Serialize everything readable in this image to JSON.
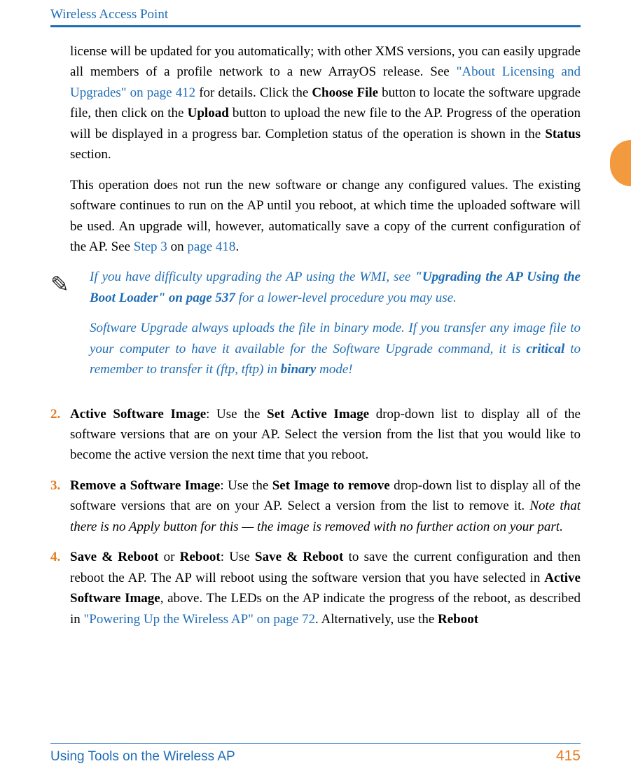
{
  "header": {
    "title": "Wireless Access Point"
  },
  "para1": {
    "t1": "license will be updated for you automatically; with other XMS versions, you can easily upgrade all members of a profile network to a new ArrayOS release. See ",
    "link1": "\"About Licensing and Upgrades\" on page 412",
    "t2": " for details. Click the ",
    "b1": "Choose File",
    "t3": " button to locate the software upgrade file, then click on the ",
    "b2": "Upload",
    "t4": " button to upload the new file to the AP. Progress of the operation will be displayed in a progress bar. Completion status of the operation is shown in the ",
    "b3": "Status",
    "t5": " section."
  },
  "para2": {
    "t1": "This operation does not run the new software or change any configured values. The existing software continues to run on the AP until you reboot, at which time the uploaded software will be used. An upgrade will, however, automatically save a copy of the current configuration of the AP. See ",
    "link1": "Step 3",
    "t2": " on ",
    "link2": "page 418",
    "t3": "."
  },
  "note": {
    "p1": {
      "t1": "If you have difficulty upgrading the AP using the WMI, see ",
      "b1": "\"Upgrading the AP Using the Boot Loader\" on page 537",
      "t2": " for a lower-level procedure you may use."
    },
    "p2": {
      "t1": "Software Upgrade always uploads the file in binary mode. If you transfer any image file to your computer to have it available for the Software Upgrade command, it is ",
      "b1": "critical",
      "t2": " to remember to transfer it (ftp, tftp) in ",
      "b2": "binary",
      "t3": " mode!"
    }
  },
  "item2": {
    "num": "2.",
    "b1": "Active Software Image",
    "t1": ": Use the ",
    "b2": "Set Active Image",
    "t2": " drop-down list to display all of the software versions that are on your AP. Select the version from the list that you would like to become the active version the next time that you reboot."
  },
  "item3": {
    "num": "3.",
    "b1": "Remove a Software Image",
    "t1": ": Use the ",
    "b2": "Set Image to remove",
    "t2": " drop-down list to display all of the software versions that are on your AP. Select a version from the list to remove it. ",
    "it1": "Note that there is no Apply button for this — the image is removed with no further action on your part."
  },
  "item4": {
    "num": "4.",
    "b1": "Save & Reboot",
    "t1": " or ",
    "b2": "Reboot",
    "t2": ": Use ",
    "b3": "Save & Reboot",
    "t3": " to save the current configuration and then reboot the AP. The AP will reboot using the software version that you have selected in ",
    "b4": "Active Software Image",
    "t4": ", above. The LEDs on the AP indicate the progress of the reboot, as described in ",
    "link1": "\"Powering Up the Wireless AP\" on page 72",
    "t5": ". Alternatively, use the ",
    "b5": "Reboot"
  },
  "footer": {
    "left": "Using Tools on the Wireless AP",
    "right": "415"
  },
  "note_icon_glyph": "✎"
}
